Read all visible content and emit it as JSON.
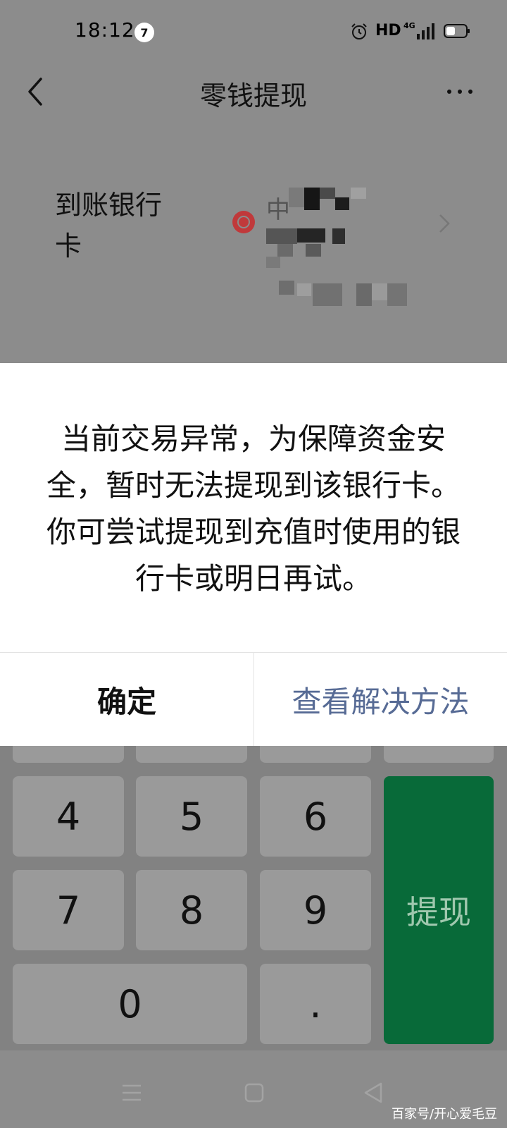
{
  "status_bar": {
    "time": "18:12",
    "notification_count": "7",
    "hd": "HD",
    "network": "4G"
  },
  "nav": {
    "title": "零钱提现"
  },
  "bank_card": {
    "label_line1": "到账银行",
    "label_line2": "卡",
    "bank_name_visible": "中"
  },
  "dialog": {
    "message_lines": [
      "当前交易异常，为保障资金安",
      "全，暂时无法提现到该银行卡。",
      "你可尝试提现到充值时使用的银",
      "行卡或明日再试。"
    ],
    "confirm_label": "确定",
    "solution_label": "查看解决方法",
    "solution_color": "#576b95"
  },
  "keypad": {
    "keys": [
      "4",
      "5",
      "6",
      "7",
      "8",
      "9",
      "0",
      "."
    ],
    "withdraw_label": "提现",
    "withdraw_color": "#086a39"
  },
  "watermark": "百家号/开心爱毛豆"
}
